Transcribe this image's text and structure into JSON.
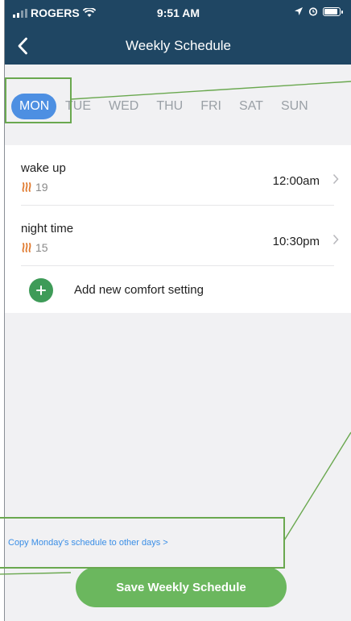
{
  "status_bar": {
    "carrier": "ROGERS",
    "time": "9:51 AM"
  },
  "header": {
    "title": "Weekly Schedule"
  },
  "days": [
    {
      "label": "MON",
      "active": true
    },
    {
      "label": "TUE",
      "active": false
    },
    {
      "label": "WED",
      "active": false
    },
    {
      "label": "THU",
      "active": false
    },
    {
      "label": "FRI",
      "active": false
    },
    {
      "label": "SAT",
      "active": false
    },
    {
      "label": "SUN",
      "active": false
    }
  ],
  "schedule": [
    {
      "name": "wake up",
      "temp": "19",
      "time": "12:00am"
    },
    {
      "name": "night time",
      "temp": "15",
      "time": "10:30pm"
    }
  ],
  "add_setting_label": "Add new comfort setting",
  "copy_link_label": "Copy Monday's schedule to other days >",
  "save_button_label": "Save Weekly Schedule",
  "colors": {
    "header_bg": "#1f4663",
    "active_day": "#4d8fe2",
    "heat_icon": "#e07a2f",
    "add_button": "#3e9b58",
    "save_button": "#6bb75e",
    "link": "#3a8ee6",
    "annotation": "#6aa84f"
  }
}
